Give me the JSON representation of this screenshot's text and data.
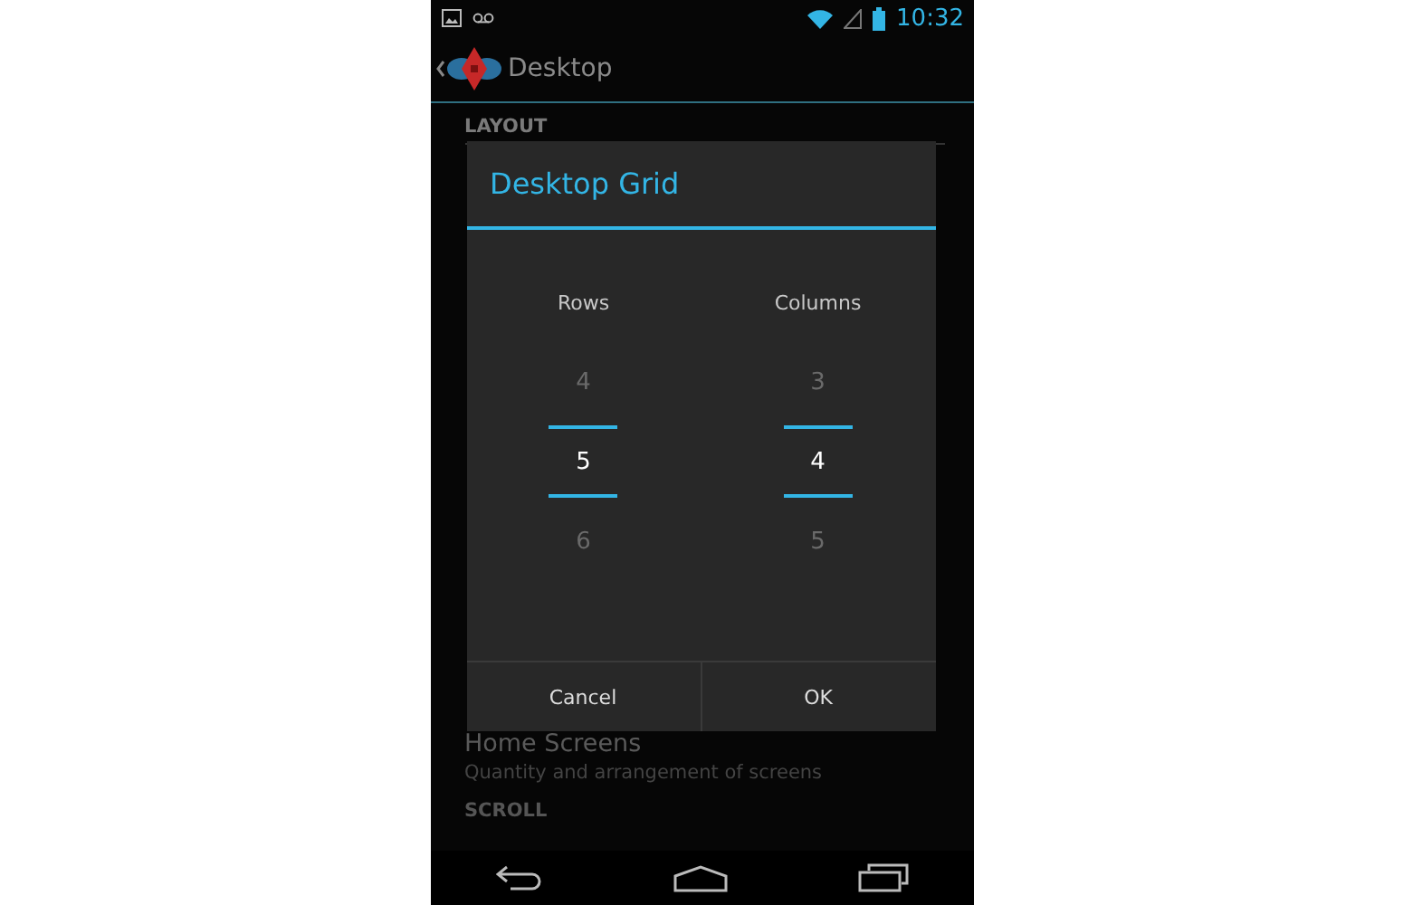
{
  "status_bar": {
    "time": "10:32"
  },
  "action_bar": {
    "title": "Desktop"
  },
  "sections": [
    {
      "header": "LAYOUT"
    }
  ],
  "dialog": {
    "title": "Desktop Grid",
    "pickers": [
      {
        "label": "Rows",
        "values": [
          {
            "text": "4",
            "selected": false
          },
          {
            "text": "5",
            "selected": true
          },
          {
            "text": "6",
            "selected": false
          }
        ]
      },
      {
        "label": "Columns",
        "values": [
          {
            "text": "3",
            "selected": false
          },
          {
            "text": "4",
            "selected": true
          },
          {
            "text": "5",
            "selected": false
          }
        ]
      }
    ],
    "buttons": [
      "Cancel",
      "OK"
    ]
  },
  "settings": [
    {
      "title": "Home Screens",
      "summary": "Quantity and arrangement of screens"
    }
  ],
  "next_section": {
    "header": "SCROLL"
  }
}
